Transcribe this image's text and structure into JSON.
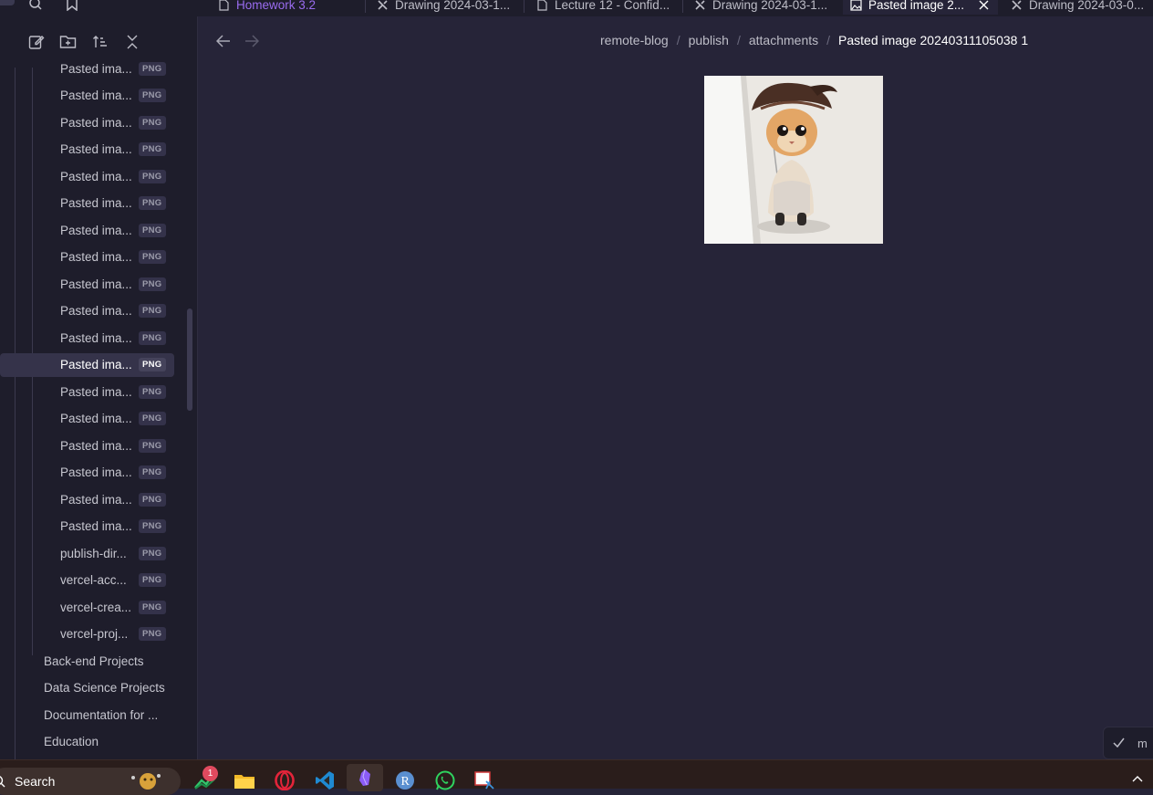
{
  "tabs": [
    {
      "label": "Homework 3.2",
      "icon": "file-icon"
    },
    {
      "label": "Drawing 2024-03-1...",
      "icon": "excalidraw-icon"
    },
    {
      "label": "Lecture 12 - Confid...",
      "icon": "file-icon"
    },
    {
      "label": "Drawing 2024-03-1...",
      "icon": "excalidraw-icon"
    },
    {
      "label": "Pasted image 2...",
      "icon": "image-icon",
      "active": true
    },
    {
      "label": "Drawing 2024-03-0...",
      "icon": "excalidraw-icon"
    }
  ],
  "sidebar": {
    "files": [
      {
        "name": "Pasted ima...",
        "ext": "PNG"
      },
      {
        "name": "Pasted ima...",
        "ext": "PNG"
      },
      {
        "name": "Pasted ima...",
        "ext": "PNG"
      },
      {
        "name": "Pasted ima...",
        "ext": "PNG"
      },
      {
        "name": "Pasted ima...",
        "ext": "PNG"
      },
      {
        "name": "Pasted ima...",
        "ext": "PNG"
      },
      {
        "name": "Pasted ima...",
        "ext": "PNG"
      },
      {
        "name": "Pasted ima...",
        "ext": "PNG"
      },
      {
        "name": "Pasted ima...",
        "ext": "PNG"
      },
      {
        "name": "Pasted ima...",
        "ext": "PNG"
      },
      {
        "name": "Pasted ima...",
        "ext": "PNG"
      },
      {
        "name": "Pasted ima...",
        "ext": "PNG",
        "selected": true
      },
      {
        "name": "Pasted ima...",
        "ext": "PNG"
      },
      {
        "name": "Pasted ima...",
        "ext": "PNG"
      },
      {
        "name": "Pasted ima...",
        "ext": "PNG"
      },
      {
        "name": "Pasted ima...",
        "ext": "PNG"
      },
      {
        "name": "Pasted ima...",
        "ext": "PNG"
      },
      {
        "name": "Pasted ima...",
        "ext": "PNG"
      },
      {
        "name": "publish-dir...",
        "ext": "PNG"
      },
      {
        "name": "vercel-acc...",
        "ext": "PNG"
      },
      {
        "name": "vercel-crea...",
        "ext": "PNG"
      },
      {
        "name": "vercel-proj...",
        "ext": "PNG"
      }
    ],
    "folders": [
      "Back-end Projects",
      "Data Science Projects",
      "Documentation for ...",
      "Education"
    ]
  },
  "breadcrumb": {
    "items": [
      "remote-blog",
      "publish",
      "attachments"
    ],
    "separator": "/",
    "current": "Pasted image 20240311105038 1"
  },
  "status": {
    "label": "m"
  },
  "taskbar": {
    "search_label": "Search",
    "notification_count": "1",
    "apps": [
      "stocks-app-icon",
      "file-explorer-icon",
      "opera-browser-icon",
      "vscode-icon",
      "obsidian-icon",
      "r-icon",
      "whatsapp-icon",
      "snipping-tool-icon"
    ]
  },
  "colors": {
    "accent": "#9a6cf0",
    "background": "#262438",
    "sidebar": "#1e1d2b"
  }
}
